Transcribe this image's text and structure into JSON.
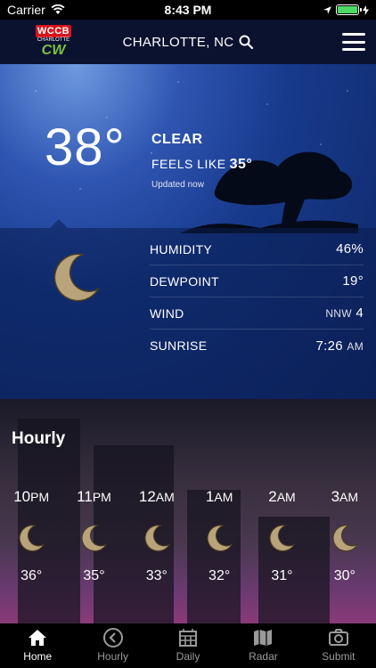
{
  "status": {
    "carrier": "Carrier",
    "time": "8:43 PM"
  },
  "header": {
    "logo_text": "WCCB",
    "logo_sub": "CHARLOTTE",
    "logo_cw": "CW",
    "location": "CHARLOTTE, NC"
  },
  "current": {
    "temp": "38°",
    "condition": "CLEAR",
    "feels_label": "FEELS LIKE",
    "feels_value": "35°",
    "updated": "Updated now"
  },
  "details": [
    {
      "label": "HUMIDITY",
      "value": "46%",
      "suffix": ""
    },
    {
      "label": "DEWPOINT",
      "value": "19°",
      "suffix": ""
    },
    {
      "label": "WIND",
      "value": "4",
      "suffix": "NNW"
    },
    {
      "label": "SUNRISE",
      "value": "7:26",
      "suffix": "AM"
    }
  ],
  "hourly": {
    "title": "Hourly",
    "hours": [
      {
        "hour": "10",
        "ampm": "PM",
        "temp": "36°"
      },
      {
        "hour": "11",
        "ampm": "PM",
        "temp": "35°"
      },
      {
        "hour": "12",
        "ampm": "AM",
        "temp": "33°"
      },
      {
        "hour": "1",
        "ampm": "AM",
        "temp": "32°"
      },
      {
        "hour": "2",
        "ampm": "AM",
        "temp": "31°"
      },
      {
        "hour": "3",
        "ampm": "AM",
        "temp": "30°"
      }
    ]
  },
  "tabs": [
    {
      "label": "Home",
      "icon": "home-icon",
      "active": true
    },
    {
      "label": "Hourly",
      "icon": "clock-icon",
      "active": false
    },
    {
      "label": "Daily",
      "icon": "calendar-icon",
      "active": false
    },
    {
      "label": "Radar",
      "icon": "map-icon",
      "active": false
    },
    {
      "label": "Submit",
      "icon": "camera-icon",
      "active": false
    }
  ],
  "colors": {
    "moon": "#b8a37a",
    "header_bg": "#0b1230",
    "logo_red": "#d7141a",
    "logo_green": "#7cc242",
    "battery": "#4cd964"
  }
}
